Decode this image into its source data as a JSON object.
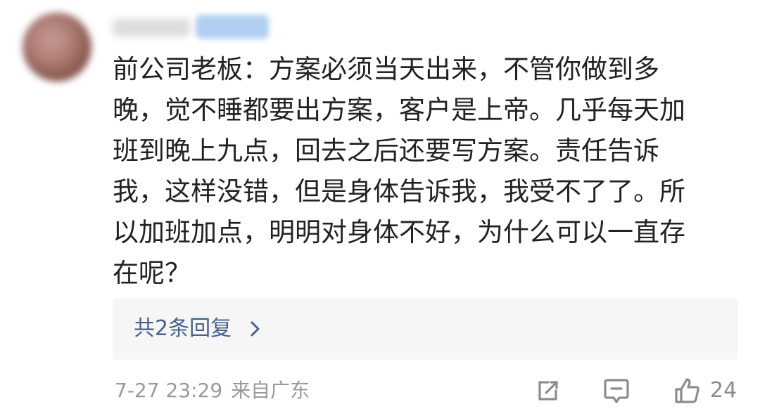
{
  "comment": {
    "text_lines": [
      "前公司老板：方案必须当天出来，不管你做到多",
      "晚，觉不睡都要出方案，客户是上帝。几乎每天加",
      "班到晚上九点，回去之后还要写方案。责任告诉",
      "我，这样没错，但是身体告诉我，我受不了了。所",
      "以加班加点，明明对身体不好，为什么可以一直存",
      "在呢？"
    ]
  },
  "replies": {
    "label": "共2条回复",
    "chevron": "›"
  },
  "meta": {
    "time": "7-27 23:29",
    "location": "来自广东"
  },
  "actions": {
    "share_icon": "share-icon",
    "comment_icon": "comment-icon",
    "like_icon": "thumbs-up-icon",
    "like_count": "24"
  },
  "colors": {
    "text": "#222222",
    "link_blue": "#45618e",
    "muted": "#9a9a9a",
    "reply_bg": "#f6f6f6"
  }
}
